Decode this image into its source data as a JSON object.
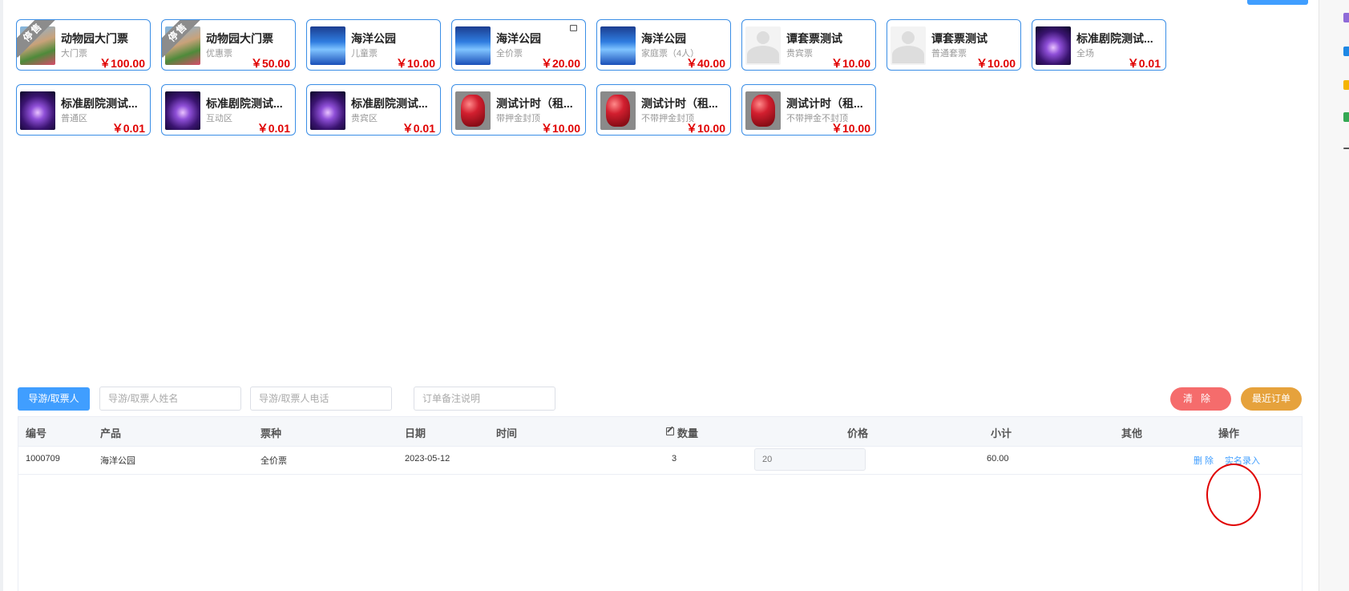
{
  "products": [
    {
      "name": "动物园大门票",
      "type": "大门票",
      "price": "￥100.00",
      "thumb": "zoo",
      "badge": "停售"
    },
    {
      "name": "动物园大门票",
      "type": "优惠票",
      "price": "￥50.00",
      "thumb": "zoo",
      "badge": "停售"
    },
    {
      "name": "海洋公园",
      "type": "儿童票",
      "price": "￥10.00",
      "thumb": "ocean"
    },
    {
      "name": "海洋公园",
      "type": "全价票",
      "price": "￥20.00",
      "thumb": "ocean",
      "tag": "tag-icon"
    },
    {
      "name": "海洋公园",
      "type": "家庭票（4人）",
      "price": "￥40.00",
      "thumb": "ocean"
    },
    {
      "name": "谭套票测试",
      "type": "贵宾票",
      "price": "￥10.00",
      "thumb": "blank"
    },
    {
      "name": "谭套票测试",
      "type": "普通套票",
      "price": "￥10.00",
      "thumb": "blank"
    },
    {
      "name": "标准剧院测试...",
      "type": "全场",
      "price": "￥0.01",
      "thumb": "theater"
    },
    {
      "name": "标准剧院测试...",
      "type": "普通区",
      "price": "￥0.01",
      "thumb": "theater"
    },
    {
      "name": "标准剧院测试...",
      "type": "互动区",
      "price": "￥0.01",
      "thumb": "theater"
    },
    {
      "name": "标准剧院测试...",
      "type": "贵宾区",
      "price": "￥0.01",
      "thumb": "theater"
    },
    {
      "name": "测试计时（租...",
      "type": "带押金封顶",
      "price": "￥10.00",
      "thumb": "fruit"
    },
    {
      "name": "测试计时（租...",
      "type": "不带押金封顶",
      "price": "￥10.00",
      "thumb": "fruit"
    },
    {
      "name": "测试计时（租...",
      "type": "不带押金不封顶",
      "price": "￥10.00",
      "thumb": "fruit"
    }
  ],
  "toolbar": {
    "guide_button": "导游/取票人",
    "name_placeholder": "导游/取票人姓名",
    "phone_placeholder": "导游/取票人电话",
    "remark_placeholder": "订单备注说明",
    "clear_button": "清除",
    "recent_button": "最近订单"
  },
  "table": {
    "headers": {
      "id": "编号",
      "product": "产品",
      "ticket_type": "票种",
      "date": "日期",
      "time": "时间",
      "quantity": "数量",
      "price": "价格",
      "subtotal": "小计",
      "other": "其他",
      "actions": "操作"
    },
    "rows": [
      {
        "id": "1000709",
        "product": "海洋公园",
        "ticket_type": "全价票",
        "date": "2023-05-12",
        "time": "",
        "quantity": "3",
        "price_placeholder": "20",
        "subtotal": "60.00",
        "other": "",
        "delete_label": "删 除",
        "realname_label": "实名录入"
      }
    ]
  },
  "colors": {
    "primary": "#409eff",
    "danger": "#f56c6c",
    "warning": "#e6a23c",
    "price": "#e00000",
    "annotation": "#e00000"
  }
}
